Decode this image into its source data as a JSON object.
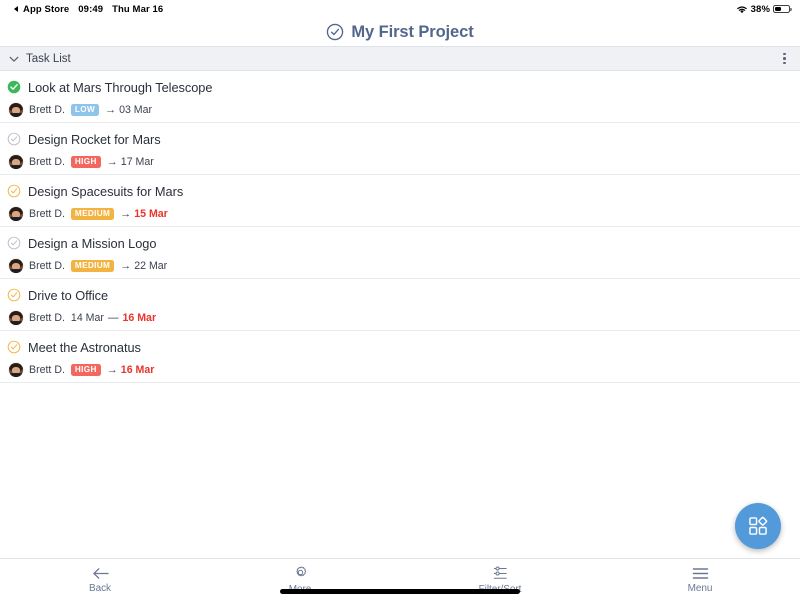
{
  "statusbar": {
    "back_app": "App Store",
    "back_icon": "triangle-left-icon",
    "time": "09:49",
    "date": "Thu Mar 16",
    "wifi_icon": "wifi-icon",
    "battery_percent": "38%",
    "battery_icon": "battery-icon",
    "battery_level": 38
  },
  "navbar": {
    "icon": "circle-check-icon",
    "title": "My First Project",
    "title_color": "#53678c"
  },
  "section": {
    "chevron_icon": "chevron-down-icon",
    "title": "Task List",
    "menu_icon": "kebab-menu-icon"
  },
  "colors": {
    "accent": "#529ada",
    "done": "#3cb75a",
    "pending_outline": "#b9bec9",
    "due_soon_outline": "#f3b340",
    "overdue_text": "#e8342a",
    "badge_low": "#8fc4ea",
    "badge_medium": "#f3b340",
    "badge_high": "#f2685f",
    "section_bg": "#eff1f5",
    "toolbar_text": "#6a7894"
  },
  "tasks": [
    {
      "title": "Look at Mars Through Telescope",
      "status": "done",
      "status_icon": "circle-check-filled-icon",
      "assignee": "Brett D.",
      "avatar_icon": "avatar",
      "priority": "LOW",
      "priority_class": "low",
      "date_icon": "arrow-right-icon",
      "date_mode": "single",
      "date": "03 Mar",
      "date_overdue": false
    },
    {
      "title": "Design Rocket for Mars",
      "status": "pending",
      "status_icon": "circle-check-outline-icon",
      "assignee": "Brett D.",
      "avatar_icon": "avatar",
      "priority": "HIGH",
      "priority_class": "high",
      "date_icon": "arrow-right-icon",
      "date_mode": "single",
      "date": "17 Mar",
      "date_overdue": false
    },
    {
      "title": "Design Spacesuits for Mars",
      "status": "due-soon",
      "status_icon": "circle-check-outline-icon",
      "assignee": "Brett D.",
      "avatar_icon": "avatar",
      "priority": "MEDIUM",
      "priority_class": "medium",
      "date_icon": "arrow-right-icon",
      "date_mode": "single",
      "date": "15 Mar",
      "date_overdue": true
    },
    {
      "title": "Design a Mission Logo",
      "status": "pending",
      "status_icon": "circle-check-outline-icon",
      "assignee": "Brett D.",
      "avatar_icon": "avatar",
      "priority": "MEDIUM",
      "priority_class": "medium",
      "date_icon": "arrow-right-icon",
      "date_mode": "single",
      "date": "22 Mar",
      "date_overdue": false
    },
    {
      "title": "Drive to Office",
      "status": "due-soon",
      "status_icon": "circle-check-outline-icon",
      "assignee": "Brett D.",
      "avatar_icon": "avatar",
      "priority": null,
      "priority_class": null,
      "date_icon": null,
      "date_mode": "range",
      "date_start": "14 Mar",
      "date_separator": "—",
      "date": "16 Mar",
      "date_overdue": true
    },
    {
      "title": "Meet the Astronatus",
      "status": "due-soon",
      "status_icon": "circle-check-outline-icon",
      "assignee": "Brett D.",
      "avatar_icon": "avatar",
      "priority": "HIGH",
      "priority_class": "high",
      "date_icon": "arrow-right-icon",
      "date_mode": "single",
      "date": "16 Mar",
      "date_overdue": true
    }
  ],
  "fab": {
    "icon": "apps-grid-icon",
    "color": "#529ada"
  },
  "toolbar": {
    "items": [
      {
        "label": "Back",
        "icon": "arrow-left-icon"
      },
      {
        "label": "More",
        "icon": "gear-icon"
      },
      {
        "label": "Filter/Sort",
        "icon": "sliders-icon"
      },
      {
        "label": "Menu",
        "icon": "hamburger-menu-icon"
      }
    ]
  }
}
